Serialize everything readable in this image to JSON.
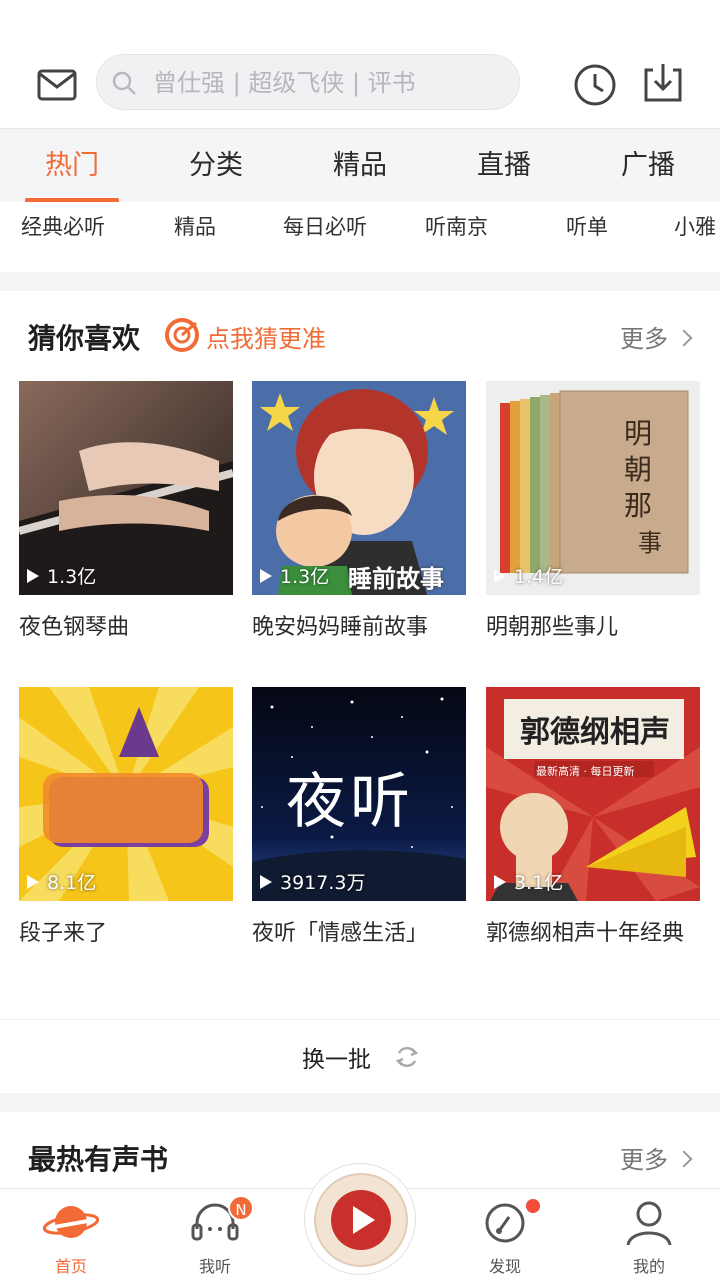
{
  "search": {
    "placeholder": "曾仕强 | 超级飞侠 | 评书"
  },
  "tabs": [
    {
      "label": "热门",
      "active": true
    },
    {
      "label": "分类"
    },
    {
      "label": "精品"
    },
    {
      "label": "直播"
    },
    {
      "label": "广播"
    }
  ],
  "subtabs": [
    "经典必听",
    "精品",
    "每日必听",
    "听南京",
    "听单",
    "小雅"
  ],
  "guess": {
    "title": "猜你喜欢",
    "link": "点我猜更准",
    "more": "更多",
    "items": [
      {
        "title": "夜色钢琴曲",
        "plays": "1.3亿"
      },
      {
        "title": "晚安妈妈睡前故事",
        "plays": "1.3亿",
        "overlay": "睡前故事"
      },
      {
        "title": "明朝那些事儿",
        "plays": "1.4亿"
      },
      {
        "title": "段子来了",
        "plays": "8.1亿"
      },
      {
        "title": "夜听「情感生活」",
        "plays": "3917.3万",
        "overlay": "夜听"
      },
      {
        "title": "郭德纲相声十年经典",
        "plays": "3.1亿",
        "overlay": "郭德纲相声",
        "overlay_sub": "最新高清 · 每日更新"
      }
    ]
  },
  "refresh": {
    "label": "换一批"
  },
  "hot_books": {
    "title": "最热有声书",
    "more": "更多"
  },
  "nav": [
    {
      "label": "首页",
      "icon": "planet-icon",
      "active": true
    },
    {
      "label": "我听",
      "icon": "headphones-icon",
      "badge": "N"
    },
    {
      "label": "",
      "icon": "play-disc-icon"
    },
    {
      "label": "发现",
      "icon": "compass-icon",
      "dot": true
    },
    {
      "label": "我的",
      "icon": "user-icon"
    }
  ],
  "colors": {
    "accent": "#f26b36",
    "badge_red": "#f44b3a"
  }
}
